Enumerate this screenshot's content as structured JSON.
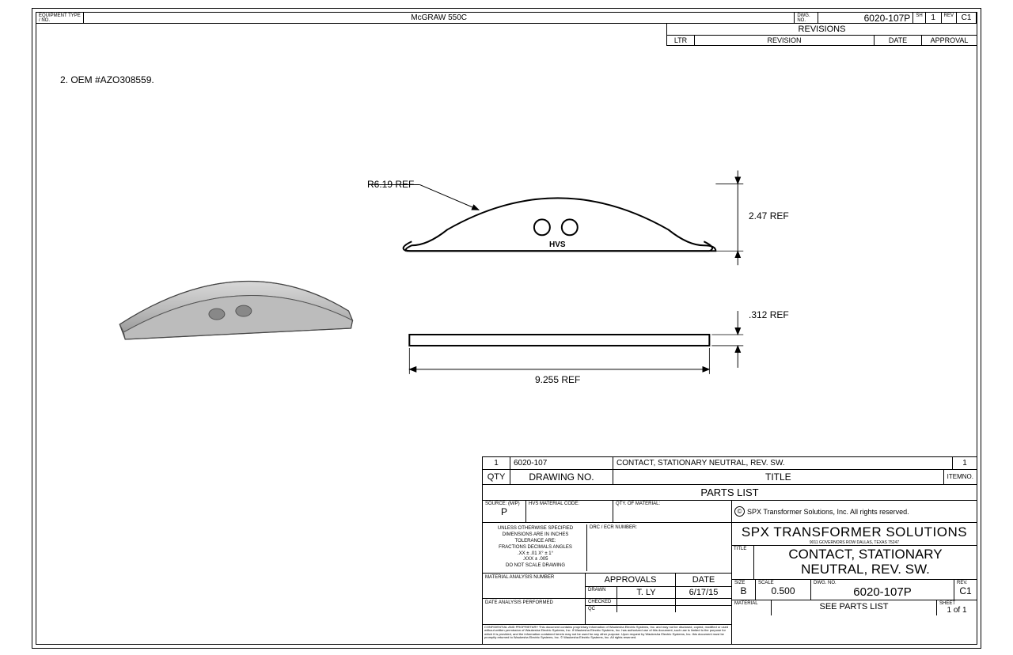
{
  "header": {
    "equipment_label": "EQUIPMENT TYPE / NO.",
    "equipment_value": "McGRAW 550C",
    "dwg_no_label": "DWG. NO.",
    "dwg_no_value": "6020-107P",
    "sh_label": "SH",
    "sh_value": "1",
    "rev_label": "REV",
    "rev_value": "C1"
  },
  "revisions": {
    "title": "REVISIONS",
    "cols": {
      "ltr": "LTR",
      "revision": "REVISION",
      "date": "DATE",
      "approval": "APPROVAL"
    }
  },
  "note": "2. OEM #AZO308559.",
  "dimensions": {
    "radius": "R6.19   REF",
    "height": "2.47 REF",
    "thickness": ".312 REF",
    "width": "9.255 REF",
    "marking": "HVS"
  },
  "parts_list": {
    "row": {
      "qty": "1",
      "drawing_no": "6020-107",
      "title": "CONTACT, STATIONARY NEUTRAL, REV. SW.",
      "item_no": "1"
    },
    "headers": {
      "qty": "QTY",
      "drawing_no": "DRAWING NO.",
      "title": "TITLE",
      "item_no_l1": "ITEM",
      "item_no_l2": "NO."
    },
    "section_title": "PARTS LIST"
  },
  "source_row": {
    "source_label": "SOURCE: (M/P)",
    "source_value": "P",
    "hvs_mat_label": "HVS MATERIAL CODE:",
    "qty_mat_label": "QTY. OF MATERIAL:",
    "copyright": "SPX Transformer Solutions, Inc. All rights reserved."
  },
  "tolerance": {
    "l1": "UNLESS OTHERWISE SPECIFIED",
    "l2": "DIMENSIONS ARE IN INCHES",
    "l3": "TOLERANCE ARE:",
    "l4": "FRACTIONS   DECIMALS   ANGLES",
    "l5": ".XX ± .01        X° ± 1°",
    "l6": ".XXX ± .005",
    "l7": "DO NOT SCALE DRAWING"
  },
  "drc_label": "DRC / ECR NUMBER:",
  "material_analysis_label": "MATERIAL ANALYSIS NUMBER",
  "date_analysis_label": "DATE ANALYSIS PERFORMED",
  "approvals": {
    "header_approvals": "APPROVALS",
    "header_date": "DATE",
    "drawn_label": "DRAWN",
    "drawn_name": "T. LY",
    "drawn_date": "6/17/15",
    "checked_label": "CHECKED",
    "qc_label": "QC"
  },
  "company": {
    "name": "SPX TRANSFORMER SOLUTIONS",
    "address": "9011 GOVERNORS ROW   DALLAS, TEXAS 75247"
  },
  "title_block": {
    "label": "TITLE",
    "line1": "CONTACT, STATIONARY",
    "line2": "NEUTRAL, REV. SW."
  },
  "dwg_block": {
    "size_label": "SIZE",
    "size": "B",
    "scale_label": "SCALE",
    "scale": "0.500",
    "dwgno_label": "DWG. NO.",
    "dwgno": "6020-107P",
    "rev_label": "REV.",
    "rev": "C1"
  },
  "material_block": {
    "label": "MATERIAL",
    "value": "SEE PARTS LIST",
    "sheet_label": "SHEET",
    "sheet_value": "1 of 1"
  },
  "proprietary": "CONFIDENTIAL AND PROPRIETARY This document contains proprietary information of Waukesha Electric Systems, Inc. and may not be disclosed, copied, modified or used without written permission of Waukesha Electric Systems, Inc. If Waukesha Electric Systems, Inc. has authorized use of this document, such use is limited to the purpose for which it is provided, and the information contained herein may not be used for any other purpose. Upon request by Waukesha Electric Systems, Inc. this document must be promptly returned to Waukesha Electric Systems, Inc. © Waukesha Electric Systems, Inc. All rights reserved."
}
